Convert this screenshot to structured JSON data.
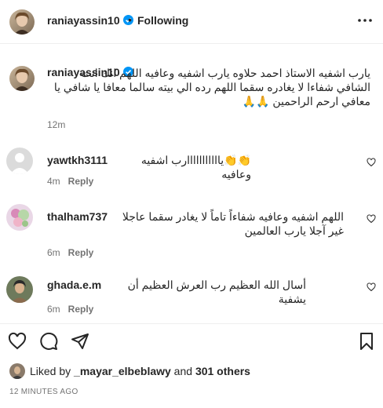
{
  "header": {
    "username": "raniayassin10",
    "separator": "•",
    "follow_label": "Following"
  },
  "caption": {
    "username": "raniayassin10",
    "text": "يارب اشفيه الاستاذ احمد حلاوه يارب اشفيه وعافيه اللهم انك انت الشافي شفاءا لا يغادره سقما اللهم رده الي بيته سالما معافا يا شافي يا معافي ارحم الراحمين 🙏🙏",
    "time": "12m"
  },
  "comments": [
    {
      "username": "yawtkh3111",
      "text": "👏👏يااااااااااارب اشفيه وعافيه",
      "time": "4m",
      "reply_label": "Reply"
    },
    {
      "username": "thalham737",
      "text": "اللهم اشفيه وعافيه شفاءاً تاماً لا يغادر سقما عاجلا غير آجلا يارب العالمين",
      "time": "6m",
      "reply_label": "Reply"
    },
    {
      "username": "ghada.e.m",
      "text": "أسال الله العظيم رب العرش العظيم أن يشفية",
      "time": "6m",
      "reply_label": "Reply"
    }
  ],
  "likes": {
    "prefix": "Liked by ",
    "user": "_mayar_elbeblawy",
    "middle": " and ",
    "others": "301 others"
  },
  "date": "12 MINUTES AGO",
  "colors": {
    "verified": "#0095f6",
    "muted": "#737373",
    "text": "#262626",
    "divider": "#efefef"
  }
}
